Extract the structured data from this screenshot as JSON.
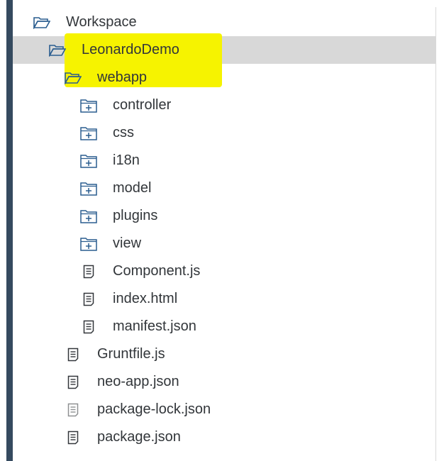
{
  "tree": {
    "root": {
      "label": "Workspace",
      "icon": "folder-open-icon"
    },
    "project": {
      "label": "LeonardoDemo",
      "icon": "folder-open-icon",
      "selected": true,
      "highlight_color": "#f6f300"
    },
    "webapp": {
      "label": "webapp",
      "icon": "folder-open-icon"
    },
    "webapp_items": [
      {
        "label": "controller",
        "icon": "folder-plus-icon"
      },
      {
        "label": "css",
        "icon": "folder-plus-icon"
      },
      {
        "label": "i18n",
        "icon": "folder-plus-icon"
      },
      {
        "label": "model",
        "icon": "folder-plus-icon"
      },
      {
        "label": "plugins",
        "icon": "folder-plus-icon"
      },
      {
        "label": "view",
        "icon": "folder-plus-icon"
      },
      {
        "label": "Component.js",
        "icon": "document-icon"
      },
      {
        "label": "index.html",
        "icon": "document-icon"
      },
      {
        "label": "manifest.json",
        "icon": "document-icon"
      }
    ],
    "project_files": [
      {
        "label": "Gruntfile.js",
        "icon": "document-icon"
      },
      {
        "label": "neo-app.json",
        "icon": "document-icon"
      },
      {
        "label": "package-lock.json",
        "icon": "document-icon",
        "dimmed": true
      },
      {
        "label": "package.json",
        "icon": "document-icon"
      }
    ]
  },
  "colors": {
    "sidebar_bar": "#354a5f",
    "selection_bg": "#d8d8d8",
    "icon_blue": "#2a5d8f",
    "text": "#32363a"
  }
}
